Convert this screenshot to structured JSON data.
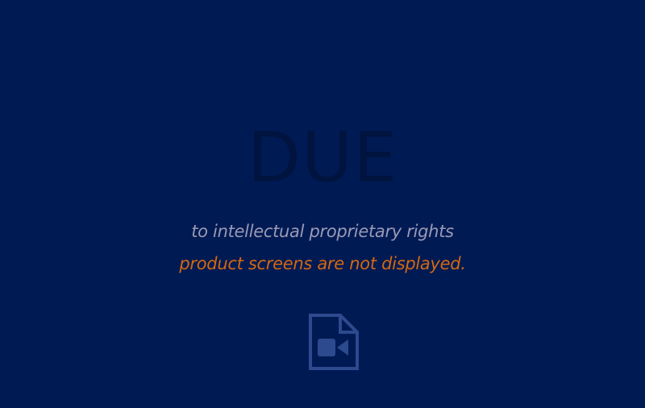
{
  "notice": {
    "headline": "DUE",
    "line1": "to intellectual proprietary rights",
    "line2": "product screens are not displayed."
  },
  "colors": {
    "background": "#001a54",
    "headline": "#00143f",
    "line1": "#9a9ab4",
    "line2": "#d3680f",
    "icon": "#2d4a8e"
  },
  "icon": "file-video-icon"
}
